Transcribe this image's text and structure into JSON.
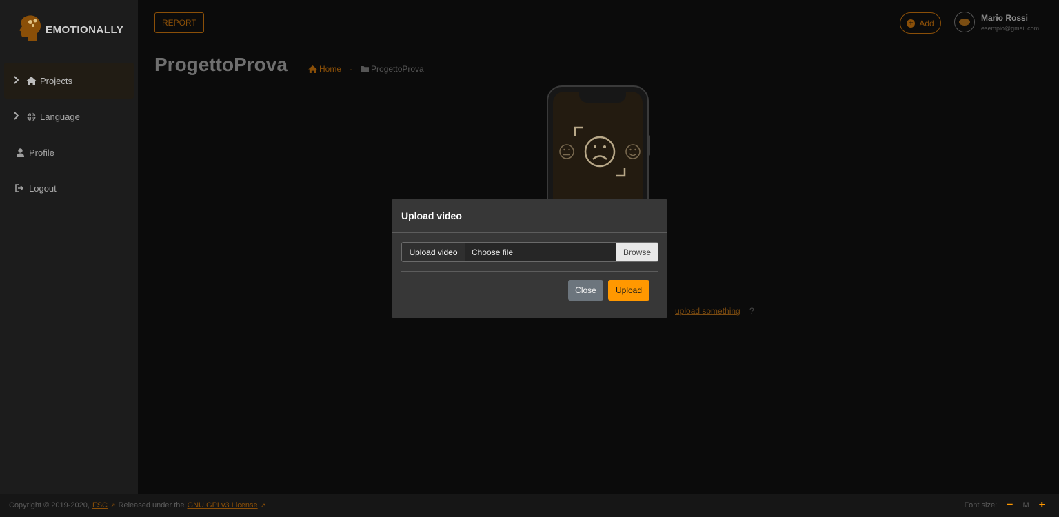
{
  "app": {
    "name": "EMOTIONALLY"
  },
  "sidebar": {
    "items": [
      {
        "label": "Projects",
        "icon": "home-icon",
        "has_chevron": true,
        "active": true
      },
      {
        "label": "Language",
        "icon": "globe-icon",
        "has_chevron": true,
        "active": false
      },
      {
        "label": "Profile",
        "icon": "user-icon",
        "has_chevron": false,
        "active": false
      },
      {
        "label": "Logout",
        "icon": "logout-icon",
        "has_chevron": false,
        "active": false
      }
    ]
  },
  "header": {
    "report_label": "REPORT",
    "add_label": "Add",
    "user": {
      "name": "Mario Rossi",
      "email": "esempio@gmail.com"
    }
  },
  "page": {
    "title": "ProgettoProva",
    "breadcrumb": {
      "home": "Home",
      "separator": "-",
      "current": "ProgettoProva"
    },
    "upload_hint": "upload something",
    "hint_suffix": "?"
  },
  "modal": {
    "title": "Upload video",
    "file_label": "Upload video",
    "file_placeholder": "Choose file",
    "browse_label": "Browse",
    "close_label": "Close",
    "upload_label": "Upload"
  },
  "footer": {
    "copyright": "Copyright © 2019-2020,",
    "fsc": "FSC",
    "released": "Released under the",
    "license": "GNU GPLv3 License",
    "font_size_label": "Font size:",
    "font_size_value": "M"
  },
  "colors": {
    "accent": "#ff9800",
    "accent_dim": "#8a4f08",
    "modal_bg": "#373737"
  }
}
